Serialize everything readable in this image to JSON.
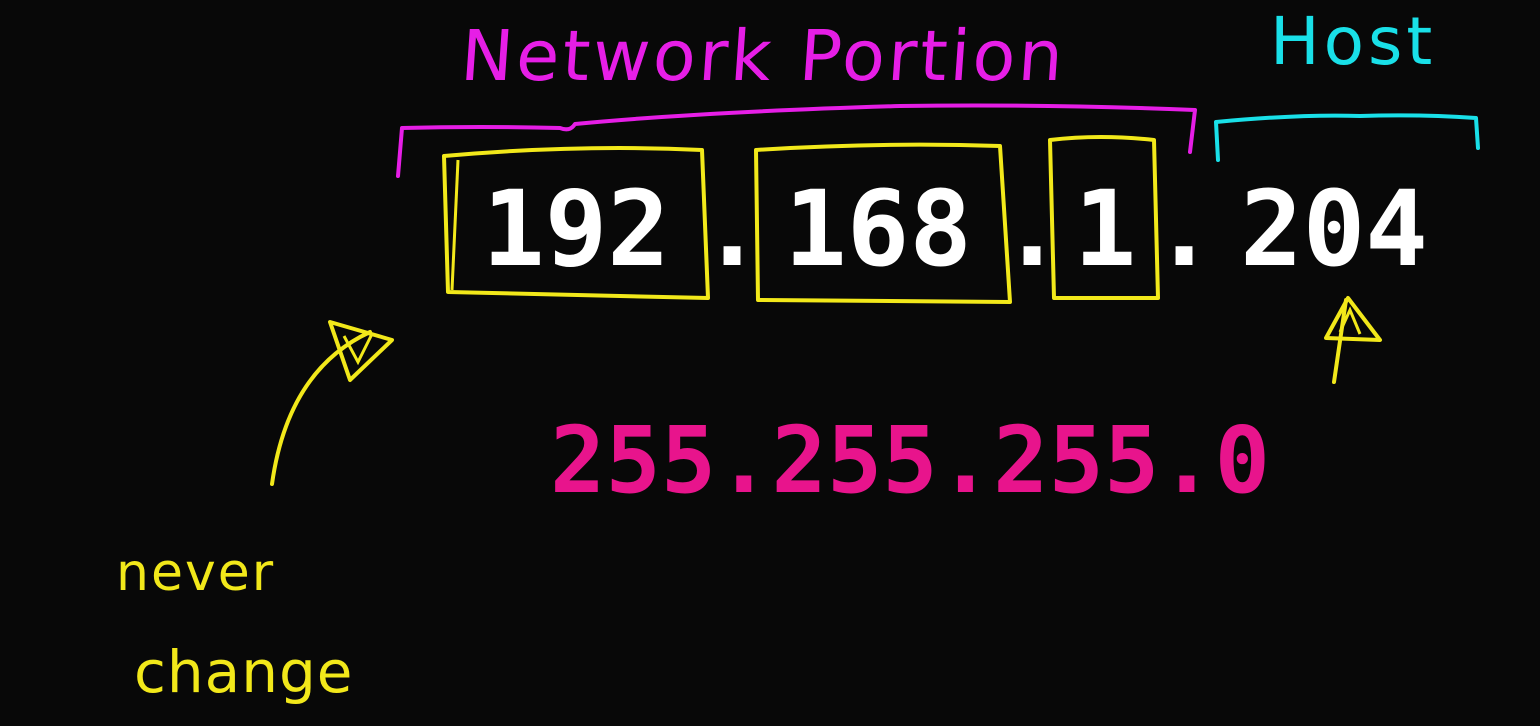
{
  "labels": {
    "network_portion": "Network Portion",
    "host": "Host",
    "never": "never",
    "change": "change"
  },
  "ip_address": {
    "octets": [
      "192",
      "168",
      "1",
      "204"
    ],
    "separators": [
      ".",
      ".",
      "."
    ]
  },
  "subnet_mask": {
    "text": "255.255.255.0"
  },
  "colors": {
    "background": "#080808",
    "ip_text": "#ffffff",
    "mask_text": "#e8148c",
    "network_annotation": "#e61ee6",
    "host_annotation": "#19e0e8",
    "octet_boxes": "#f2e81a",
    "never_change_note": "#f2e81a"
  }
}
